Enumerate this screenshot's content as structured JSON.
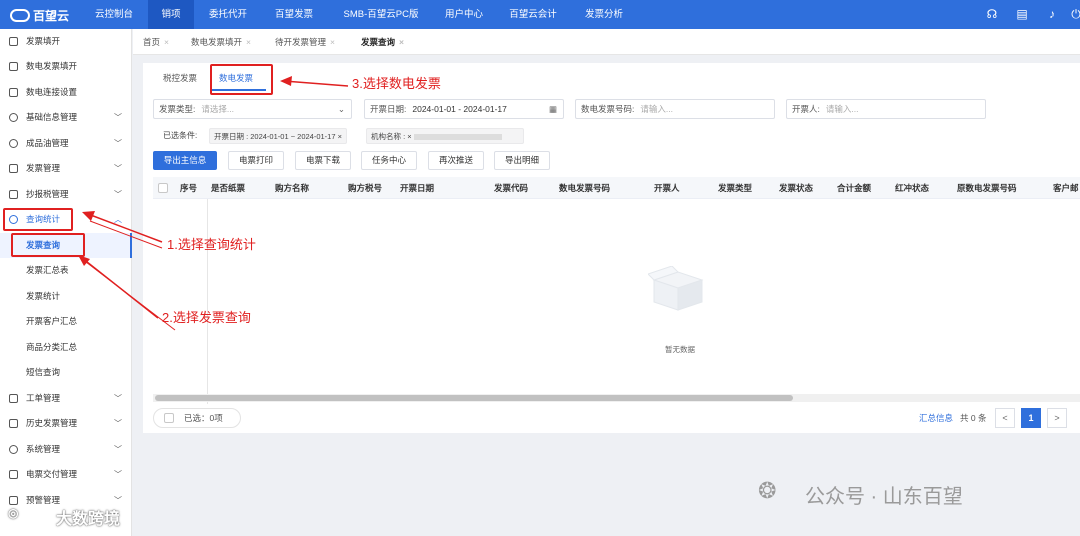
{
  "brand": {
    "name": "百望云"
  },
  "top_nav": [
    "云控制台",
    "销项",
    "委托代开",
    "百望发票",
    "SMB-百望云PC版",
    "用户中心",
    "百望云会计",
    "发票分析"
  ],
  "top_icons": [
    "headset-icon",
    "document-icon",
    "bell-icon",
    "power-icon"
  ],
  "sidebar": {
    "items": [
      {
        "label": "发票填开",
        "icon": "invoice-icon"
      },
      {
        "label": "数电发票填开",
        "icon": "invoice-icon"
      },
      {
        "label": "数电连接设置",
        "icon": "grid-icon"
      },
      {
        "label": "基础信息管理",
        "icon": "info-icon"
      },
      {
        "label": "成品油管理",
        "icon": "gear-icon"
      },
      {
        "label": "发票管理",
        "icon": "invoice-icon"
      },
      {
        "label": "抄报税管理",
        "icon": "tax-icon"
      },
      {
        "label": "查询统计",
        "icon": "query-icon"
      }
    ],
    "sub_items": [
      "发票查询",
      "发票汇总表",
      "发票统计",
      "开票客户汇总",
      "商品分类汇总",
      "短信查询"
    ],
    "items_after": [
      "工单管理",
      "历史发票管理",
      "系统管理",
      "电票交付管理",
      "预警管理"
    ]
  },
  "tabs": [
    "首页",
    "数电发票填开",
    "待开发票管理",
    "发票查询"
  ],
  "subtabs": [
    "税控发票",
    "数电发票"
  ],
  "filters": {
    "invoice_type_label": "发票类型:",
    "invoice_type_placeholder": "请选择...",
    "date_label": "开票日期:",
    "date_value": "2024-01-01 - 2024-01-17",
    "number_label": "数电发票号码:",
    "number_placeholder": "请输入...",
    "drawer_label": "开票人:",
    "drawer_placeholder": "请输入..."
  },
  "conditions": {
    "label": "已选条件:",
    "chip1": "开票日期 : 2024-01-01 ~ 2024-01-17 ×",
    "chip2": "机构名称 : ×"
  },
  "actions": [
    "导出主信息",
    "电票打印",
    "电票下载",
    "任务中心",
    "再次推送",
    "导出明细"
  ],
  "table": {
    "columns": [
      "序号",
      "是否纸票",
      "购方名称",
      "购方税号",
      "开票日期",
      "发票代码",
      "数电发票号码",
      "开票人",
      "发票类型",
      "发票状态",
      "合计金额",
      "红冲状态",
      "原数电发票号码",
      "客户邮"
    ],
    "empty_text": "暂无数据"
  },
  "footer": {
    "selected": "已选：0项",
    "summary_link": "汇总信息",
    "total": "共 0 条",
    "current_page": "1",
    "prev": "<",
    "next": ">"
  },
  "annotations": [
    "3.选择数电发票",
    "1.选择查询统计",
    "2.选择发票查询"
  ],
  "watermark": {
    "left": "大数跨境",
    "right": "公众号 · 山东百望"
  },
  "colors": {
    "primary": "#2f6fdc",
    "annotation": "#e02020"
  }
}
